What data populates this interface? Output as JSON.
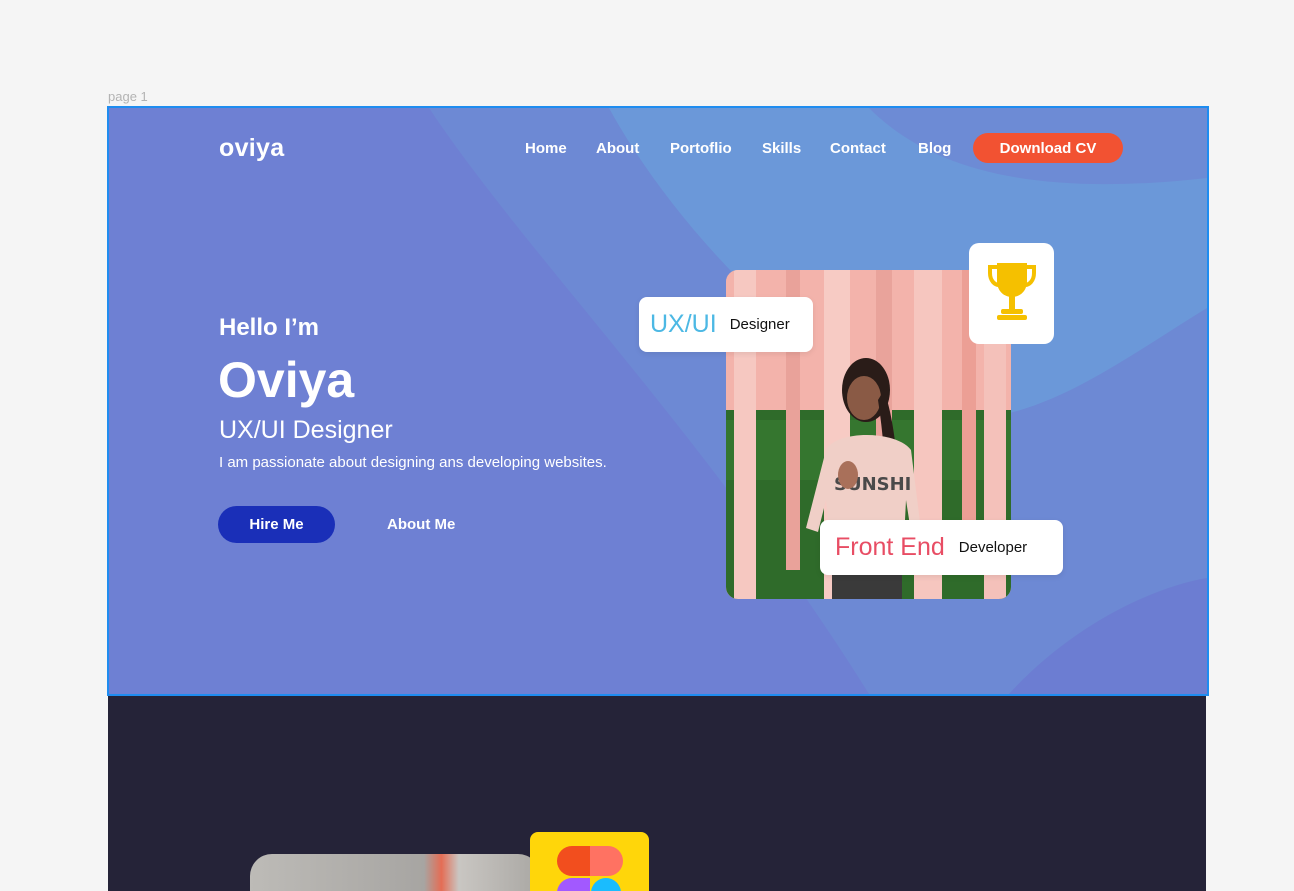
{
  "canvas": {
    "page_label": "page 1"
  },
  "header": {
    "logo": "oviya",
    "nav": [
      "Home",
      "About",
      "Portoflio",
      "Skills",
      "Contact",
      "Blog"
    ],
    "cta": "Download CV"
  },
  "hero": {
    "greeting": "Hello I’m",
    "name": "Oviya",
    "role": "UX/UI Designer",
    "description": "I am passionate about designing  ans developing websites.",
    "primary_button": "Hire Me",
    "secondary_link": "About Me"
  },
  "badges": {
    "ux": {
      "accent": "UX/UI",
      "label": "Designer"
    },
    "fe": {
      "accent": "Front End",
      "label": "Developer"
    }
  },
  "icons": {
    "trophy": "trophy-icon",
    "figma": "figma-icon"
  },
  "colors": {
    "hero_bg": "#6e80d3",
    "cta": "#f25232",
    "primary_button": "#1a2fb8",
    "ux_accent": "#4cb8e4",
    "fe_accent": "#e84d64",
    "trophy": "#f5c000",
    "dark_section": "#252338"
  }
}
